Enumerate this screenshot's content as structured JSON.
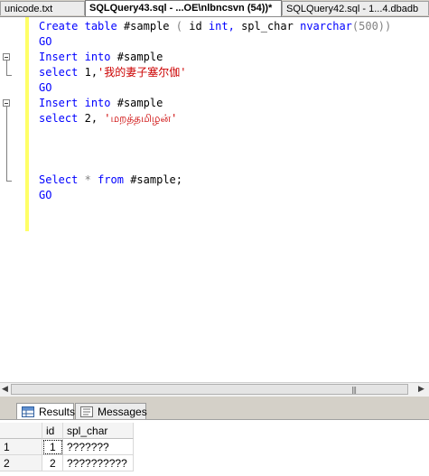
{
  "tabs": [
    {
      "label": "unicode.txt",
      "active": false
    },
    {
      "label": "SQLQuery43.sql - ...OE\\nlbncsvn (54))*",
      "active": true
    },
    {
      "label": "SQLQuery42.sql - 1...4.dbadb",
      "active": false
    }
  ],
  "code": {
    "line1": {
      "kw1": "Create",
      "kw2": "table",
      "t1": "#sample",
      "p1": "(",
      "t2": "id",
      "kw3": "int,",
      "t3": "spl_char",
      "kw4": "nvarchar",
      "p2": "(500))"
    },
    "line2": {
      "kw": "GO"
    },
    "line3": {
      "kw1": "Insert",
      "kw2": "into",
      "t1": "#sample"
    },
    "line4": {
      "kw": "select",
      "t1": "1,",
      "s": "'我的妻子塞尔伽'"
    },
    "line5": {
      "kw": "GO"
    },
    "line6": {
      "kw1": "Insert",
      "kw2": "into",
      "t1": "#sample"
    },
    "line7": {
      "kw": "select",
      "t1": "2,",
      "s": "'மறத்தமிழன்'"
    },
    "line8": {
      "kw1": "Select",
      "star": "*",
      "kw2": "from",
      "t1": "#sample;"
    },
    "line9": {
      "kw": "GO"
    }
  },
  "scrollbar": {
    "grip": "|||"
  },
  "results_tabs": [
    {
      "label": "Results",
      "icon": "grid-icon",
      "active": true
    },
    {
      "label": "Messages",
      "icon": "messages-icon",
      "active": false
    }
  ],
  "grid": {
    "columns": [
      "id",
      "spl_char"
    ],
    "rows": [
      {
        "num": "1",
        "id": "1",
        "spl_char": "???????"
      },
      {
        "num": "2",
        "id": "2",
        "spl_char": "??????????"
      }
    ]
  }
}
